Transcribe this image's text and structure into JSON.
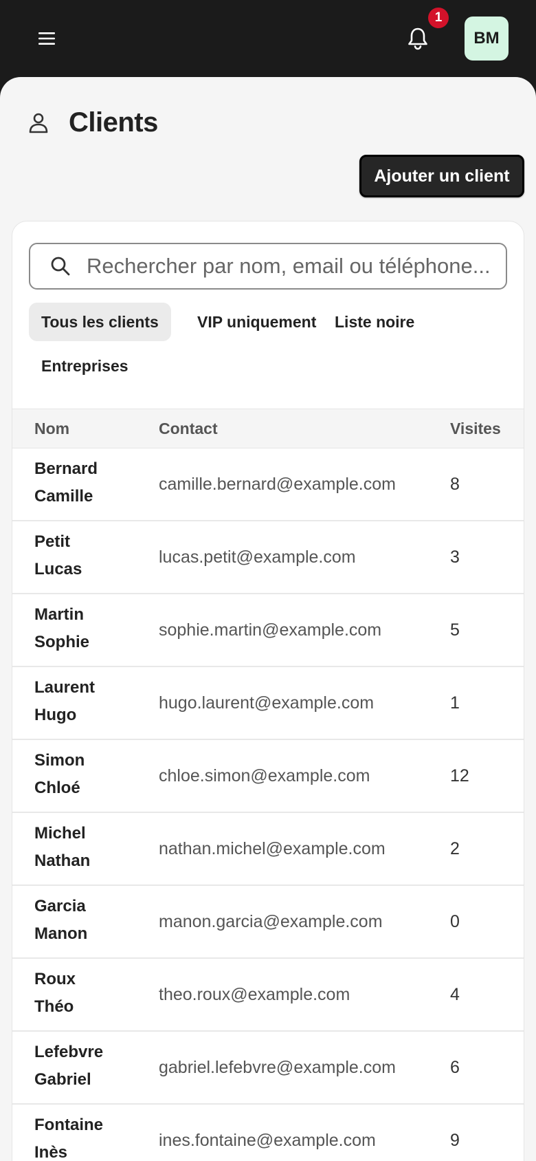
{
  "header": {
    "notification_count": "1",
    "avatar_initials": "BM"
  },
  "page": {
    "title": "Clients",
    "add_button_label": "Ajouter un client"
  },
  "search": {
    "placeholder": "Rechercher par nom, email ou téléphone..."
  },
  "filters": {
    "all": "Tous les clients",
    "vip": "VIP uniquement",
    "blacklist": "Liste noire",
    "companies": "Entreprises",
    "active": "all"
  },
  "table": {
    "columns": {
      "name": "Nom",
      "contact": "Contact",
      "visits": "Visites"
    },
    "rows": [
      {
        "last": "Bernard",
        "first": "Camille",
        "email": "camille.bernard@example.com",
        "visits": "8"
      },
      {
        "last": "Petit",
        "first": "Lucas",
        "email": "lucas.petit@example.com",
        "visits": "3"
      },
      {
        "last": "Martin",
        "first": "Sophie",
        "email": "sophie.martin@example.com",
        "visits": "5"
      },
      {
        "last": "Laurent",
        "first": "Hugo",
        "email": "hugo.laurent@example.com",
        "visits": "1"
      },
      {
        "last": "Simon",
        "first": "Chloé",
        "email": "chloe.simon@example.com",
        "visits": "12"
      },
      {
        "last": "Michel",
        "first": "Nathan",
        "email": "nathan.michel@example.com",
        "visits": "2"
      },
      {
        "last": "Garcia",
        "first": "Manon",
        "email": "manon.garcia@example.com",
        "visits": "0"
      },
      {
        "last": "Roux",
        "first": "Théo",
        "email": "theo.roux@example.com",
        "visits": "4"
      },
      {
        "last": "Lefebvre",
        "first": "Gabriel",
        "email": "gabriel.lefebvre@example.com",
        "visits": "6"
      },
      {
        "last": "Fontaine",
        "first": "Inès",
        "email": "ines.fontaine@example.com",
        "visits": "9"
      }
    ]
  },
  "colors": {
    "topbar": "#1b1b1b",
    "badge": "#d3122a",
    "avatar_bg": "#d4f5e2",
    "primary_button": "#262626"
  }
}
